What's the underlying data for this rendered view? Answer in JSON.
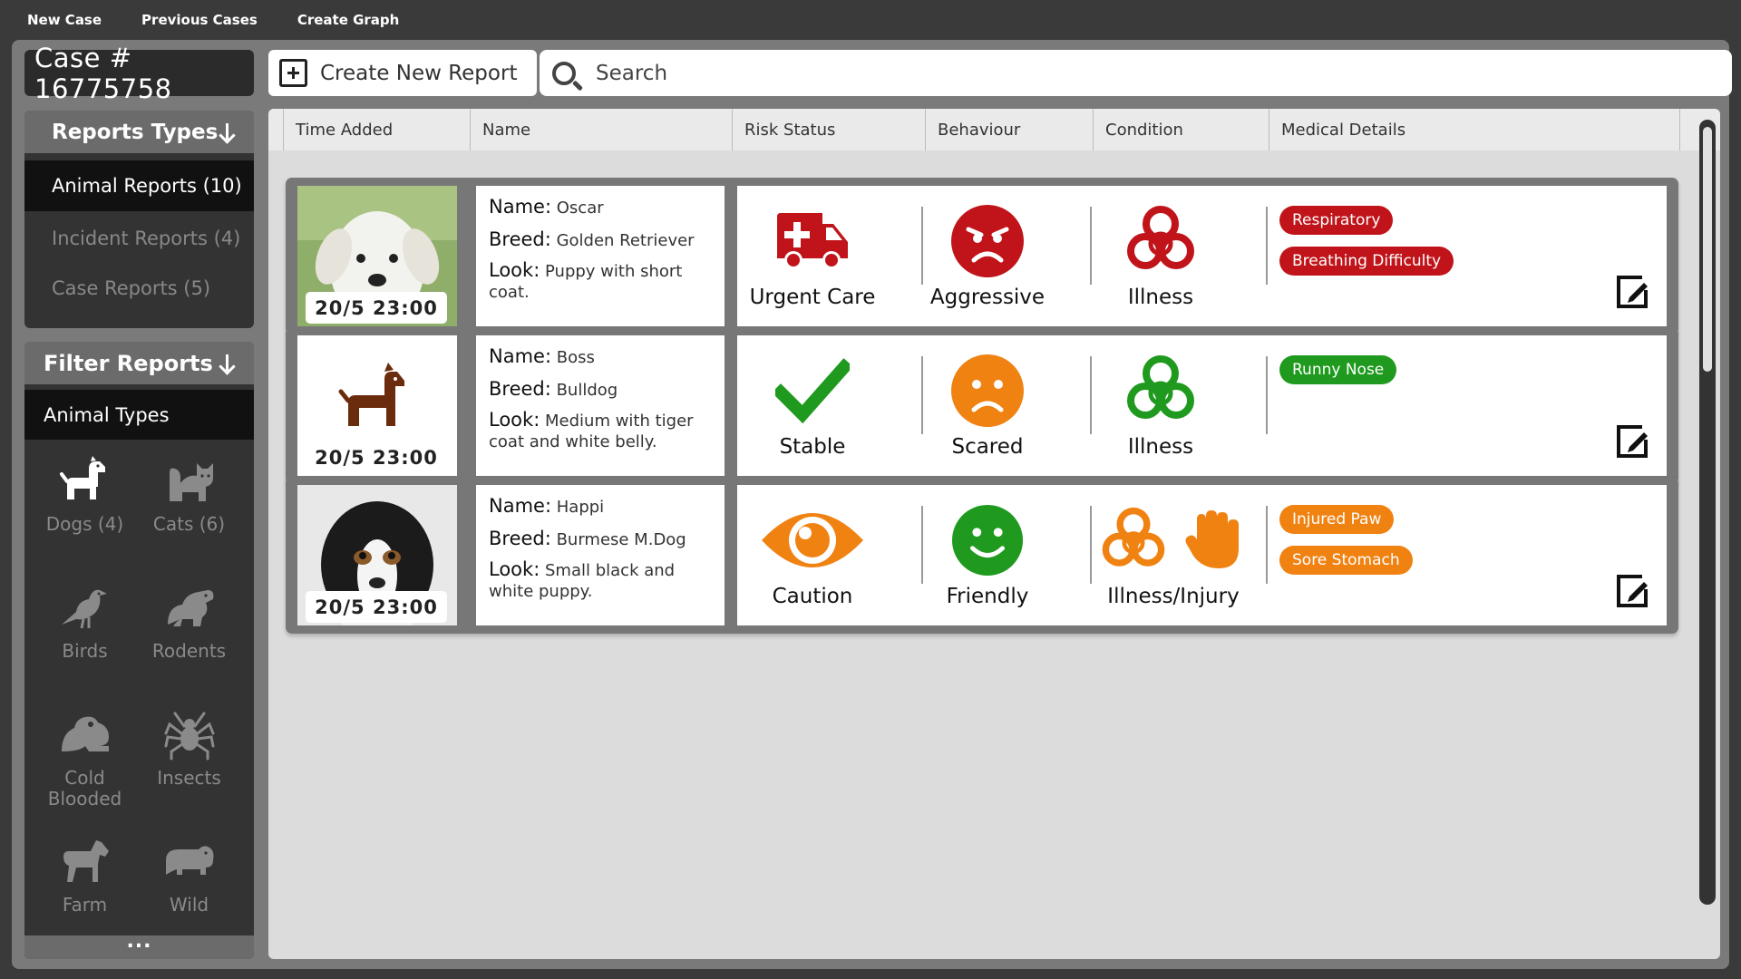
{
  "menu": {
    "new_case": "New Case",
    "previous_cases": "Previous Cases",
    "create_graph": "Create Graph"
  },
  "case_id": "Case # 16775758",
  "create_report_label": "Create New Report",
  "search": {
    "placeholder": "Search",
    "value": ""
  },
  "report_types": {
    "title": "Reports Types",
    "items": [
      {
        "label": "Animal Reports (10)"
      },
      {
        "label": "Incident Reports (4)"
      },
      {
        "label": "Case Reports (5)"
      }
    ]
  },
  "filter": {
    "title": "Filter Reports",
    "subtitle": "Animal Types",
    "animals": [
      {
        "label": "Dogs",
        "count": "(4)",
        "icon": "dog-icon"
      },
      {
        "label": "Cats",
        "count": "(6)",
        "icon": "cat-icon"
      },
      {
        "label": "Birds",
        "count": "",
        "icon": "bird-icon"
      },
      {
        "label": "Rodents",
        "count": "",
        "icon": "rodent-icon"
      },
      {
        "label": "Cold Blooded",
        "count": "",
        "icon": "frog-icon"
      },
      {
        "label": "Insects",
        "count": "",
        "icon": "spider-icon"
      },
      {
        "label": "Farm",
        "count": "",
        "icon": "horse-icon"
      },
      {
        "label": "Wild",
        "count": "",
        "icon": "hippo-icon"
      }
    ],
    "more": "..."
  },
  "columns": [
    "Time Added",
    "Name",
    "Risk Status",
    "Behaviour",
    "Condition",
    "Medical Details"
  ],
  "labels": {
    "name": "Name:",
    "breed": "Breed:",
    "look": "Look:"
  },
  "colors": {
    "red": "#c0141a",
    "green": "#1f9a1f",
    "orange": "#f08212",
    "dog_brown": "#6b2c0d"
  },
  "reports": [
    {
      "time": "20/5 23:00",
      "name": "Oscar",
      "breed": "Golden Retriever",
      "look": "Puppy with short coat.",
      "risk": "Urgent Care",
      "behaviour": "Aggressive",
      "condition": "Illness",
      "tags": [
        "Respiratory",
        "Breathing Difficulty"
      ]
    },
    {
      "time": "20/5 23:00",
      "name": "Boss",
      "breed": "Bulldog",
      "look": "Medium with tiger coat and white belly.",
      "risk": "Stable",
      "behaviour": "Scared",
      "condition": "Illness",
      "tags": [
        "Runny Nose"
      ]
    },
    {
      "time": "20/5 23:00",
      "name": "Happi",
      "breed": "Burmese M.Dog",
      "look": "Small black and white puppy.",
      "risk": "Caution",
      "behaviour": "Friendly",
      "condition": "Illness/Injury",
      "tags": [
        "Injured Paw",
        "Sore Stomach"
      ]
    }
  ]
}
